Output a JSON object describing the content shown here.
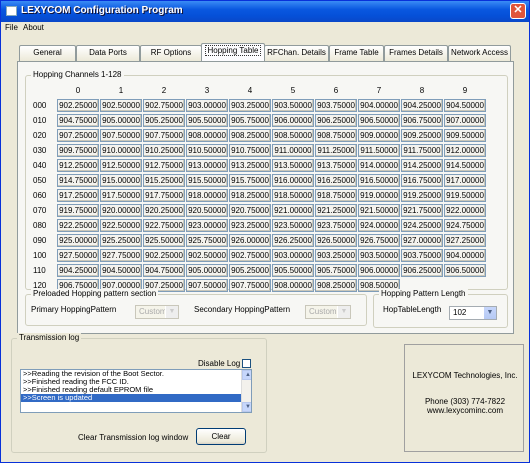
{
  "title": "LEXYCOM Configuration Program",
  "menu": [
    "File",
    "About"
  ],
  "tabs": [
    "General",
    "Data Ports",
    "RF Options",
    "Hopping Table",
    "RFChan. Details",
    "Frame Table",
    "Frames Details",
    "Network Access"
  ],
  "active_tab": "Hopping Table",
  "hopping": {
    "group_title": "Hopping Channels 1-128",
    "columns": [
      "0",
      "1",
      "2",
      "3",
      "4",
      "5",
      "6",
      "7",
      "8",
      "9"
    ],
    "rows": [
      {
        "label": "000",
        "values": [
          "902.25000",
          "902.50000",
          "902.75000",
          "903.00000",
          "903.25000",
          "903.50000",
          "903.75000",
          "904.00000",
          "904.25000",
          "904.50000"
        ]
      },
      {
        "label": "010",
        "values": [
          "904.75000",
          "905.00000",
          "905.25000",
          "905.50000",
          "905.75000",
          "906.00000",
          "906.25000",
          "906.50000",
          "906.75000",
          "907.00000"
        ]
      },
      {
        "label": "020",
        "values": [
          "907.25000",
          "907.50000",
          "907.75000",
          "908.00000",
          "908.25000",
          "908.50000",
          "908.75000",
          "909.00000",
          "909.25000",
          "909.50000"
        ]
      },
      {
        "label": "030",
        "values": [
          "909.75000",
          "910.00000",
          "910.25000",
          "910.50000",
          "910.75000",
          "911.00000",
          "911.25000",
          "911.50000",
          "911.75000",
          "912.00000"
        ]
      },
      {
        "label": "040",
        "values": [
          "912.25000",
          "912.50000",
          "912.75000",
          "913.00000",
          "913.25000",
          "913.50000",
          "913.75000",
          "914.00000",
          "914.25000",
          "914.50000"
        ]
      },
      {
        "label": "050",
        "values": [
          "914.75000",
          "915.00000",
          "915.25000",
          "915.50000",
          "915.75000",
          "916.00000",
          "916.25000",
          "916.50000",
          "916.75000",
          "917.00000"
        ]
      },
      {
        "label": "060",
        "values": [
          "917.25000",
          "917.50000",
          "917.75000",
          "918.00000",
          "918.25000",
          "918.50000",
          "918.75000",
          "919.00000",
          "919.25000",
          "919.50000"
        ]
      },
      {
        "label": "070",
        "values": [
          "919.75000",
          "920.00000",
          "920.25000",
          "920.50000",
          "920.75000",
          "921.00000",
          "921.25000",
          "921.50000",
          "921.75000",
          "922.00000"
        ]
      },
      {
        "label": "080",
        "values": [
          "922.25000",
          "922.50000",
          "922.75000",
          "923.00000",
          "923.25000",
          "923.50000",
          "923.75000",
          "924.00000",
          "924.25000",
          "924.75000"
        ]
      },
      {
        "label": "090",
        "values": [
          "925.00000",
          "925.25000",
          "925.50000",
          "925.75000",
          "926.00000",
          "926.25000",
          "926.50000",
          "926.75000",
          "927.00000",
          "927.25000"
        ]
      },
      {
        "label": "100",
        "values": [
          "927.50000",
          "927.75000",
          "902.25000",
          "902.50000",
          "902.75000",
          "903.00000",
          "903.25000",
          "903.50000",
          "903.75000",
          "904.00000"
        ]
      },
      {
        "label": "110",
        "values": [
          "904.25000",
          "904.50000",
          "904.75000",
          "905.00000",
          "905.25000",
          "905.50000",
          "905.75000",
          "906.00000",
          "906.25000",
          "906.50000"
        ]
      },
      {
        "label": "120",
        "values": [
          "906.75000",
          "907.00000",
          "907.25000",
          "907.50000",
          "907.75000",
          "908.00000",
          "908.25000",
          "908.50000"
        ]
      }
    ]
  },
  "preloaded": {
    "group_title": "Preloaded Hopping pattern section",
    "primary_label": "Primary HoppingPattern",
    "primary_value": "Custom",
    "secondary_label": "Secondary HoppingPattern",
    "secondary_value": "Custom"
  },
  "pattern_length": {
    "group_title": "Hopping Pattern Length",
    "label": "HopTableLength",
    "value": "102"
  },
  "log": {
    "group_title": "Transmission log",
    "disable_label": "Disable Log",
    "lines": [
      ">>Reading the revision of the Boot Sector.",
      ">>Finished reading the FCC ID.",
      ">>Finished reading default EPROM file",
      ">>Screen is updated"
    ],
    "selected_index": 3,
    "clear_label": "Clear Transmission log window",
    "clear_button": "Clear"
  },
  "company": {
    "name": "LEXYCOM Technologies, Inc.",
    "phone": "Phone (303) 774-7822",
    "web": "www.lexycominc.com"
  }
}
